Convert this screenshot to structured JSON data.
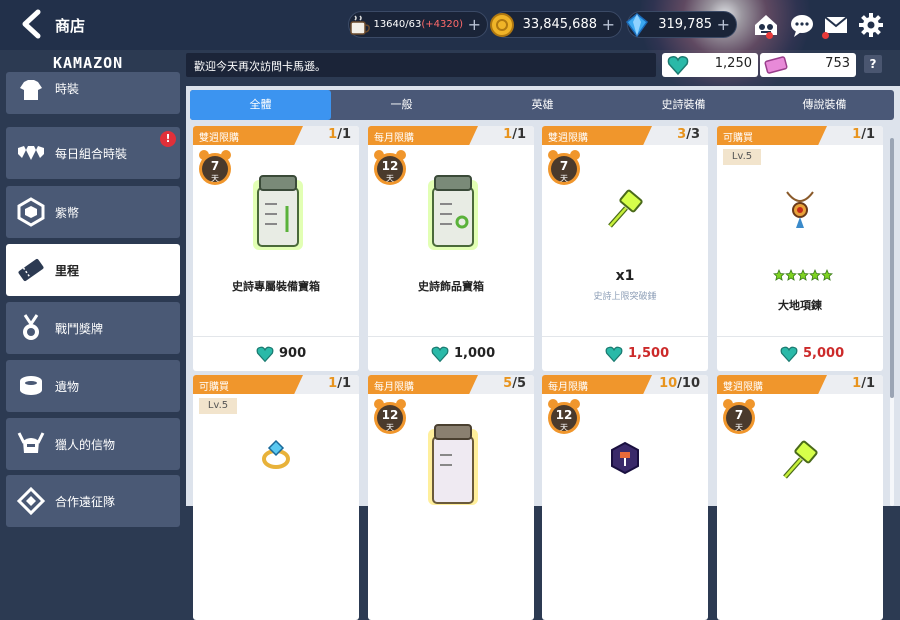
{
  "header": {
    "title": "商店",
    "logo": "KAMAZON",
    "coffee": {
      "value": "13640/63",
      "bonus": "(+4320)"
    },
    "gold": {
      "value": "33,845,688"
    },
    "gem": {
      "value": "319,785"
    },
    "notice": "歡迎今天再次訪問卡馬遜。",
    "currency_heart": "1,250",
    "currency_ticket": "753",
    "help": "?"
  },
  "sidebar": {
    "items": [
      {
        "label": "時裝"
      },
      {
        "label": "每日組合時裝",
        "badge": "!"
      },
      {
        "label": "紫幣"
      },
      {
        "label": "里程"
      },
      {
        "label": "戰鬥獎牌"
      },
      {
        "label": "遺物"
      },
      {
        "label": "獵人的信物"
      },
      {
        "label": "合作遠征隊"
      }
    ]
  },
  "tabs": [
    "全體",
    "一般",
    "英雄",
    "史詩裝備",
    "傳說裝備"
  ],
  "cards": [
    {
      "tag": "雙週限購",
      "bought": "1",
      "limit": "/1",
      "timer": "7",
      "timer_unit": "天",
      "name": "史詩專屬裝備寶箱",
      "price": "900",
      "price_red": false
    },
    {
      "tag": "每月限購",
      "bought": "1",
      "limit": "/1",
      "timer": "12",
      "timer_unit": "天",
      "name": "史詩飾品寶箱",
      "price": "1,000",
      "price_red": false
    },
    {
      "tag": "雙週限購",
      "bought": "3",
      "limit": "/3",
      "timer": "7",
      "timer_unit": "天",
      "qty": "x1",
      "sub": "史詩上限突破錘",
      "price": "1,500",
      "price_red": true
    },
    {
      "tag": "可購買",
      "bought": "1",
      "limit": "/1",
      "level": "Lv.5",
      "name": "大地項鍊",
      "price": "5,000",
      "price_red": true
    },
    {
      "tag": "可購買",
      "bought": "1",
      "limit": "/1",
      "level": "Lv.5"
    },
    {
      "tag": "每月限購",
      "bought": "5",
      "limit": "/5",
      "timer": "12",
      "timer_unit": "天"
    },
    {
      "tag": "每月限購",
      "bought": "10",
      "limit": "/10",
      "timer": "12",
      "timer_unit": "天"
    },
    {
      "tag": "雙週限購",
      "bought": "1",
      "limit": "/1",
      "timer": "7",
      "timer_unit": "天"
    }
  ],
  "colors": {
    "accent": "#3c94f0",
    "tag": "#f0962c",
    "price_red": "#cc2a2a"
  }
}
